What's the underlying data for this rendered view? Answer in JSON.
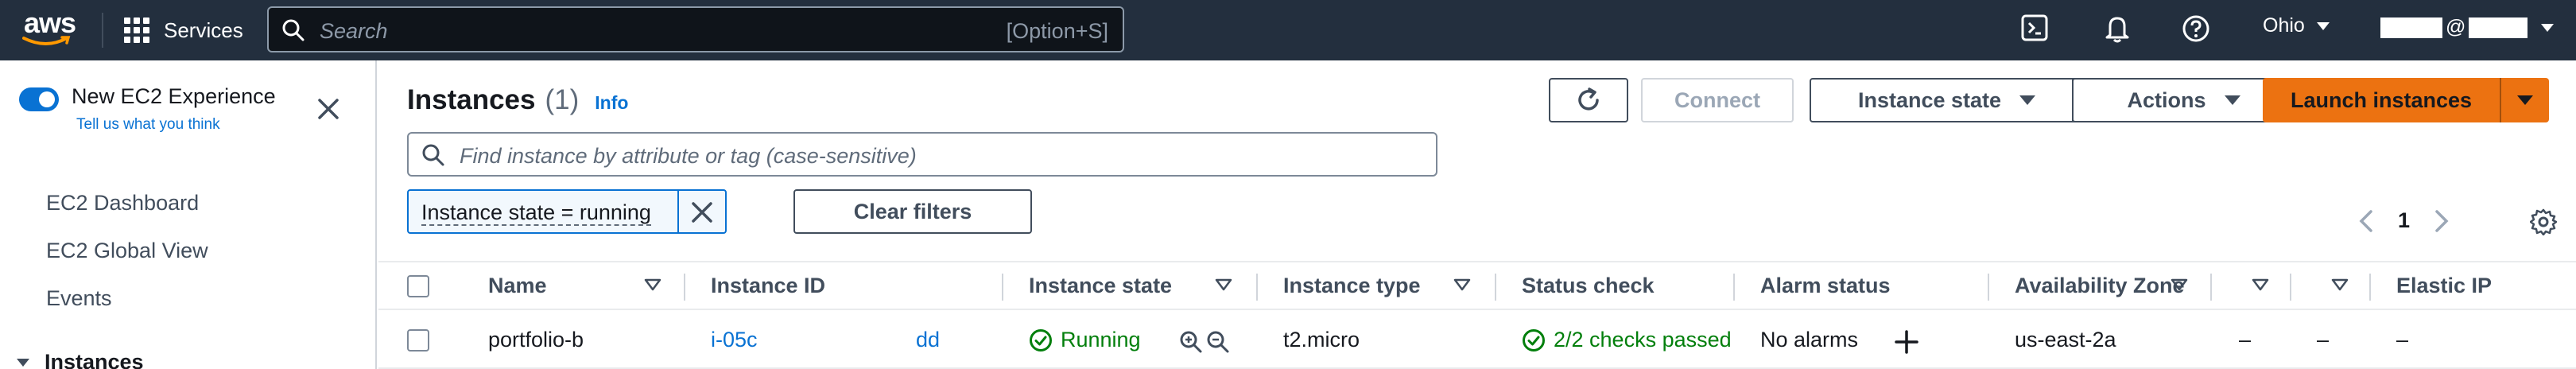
{
  "nav": {
    "logo_text": "aws",
    "services_label": "Services",
    "search_placeholder": "Search",
    "search_shortcut": "[Option+S]",
    "region": "Ohio",
    "account_at": "@"
  },
  "sidebar": {
    "experience_label": "New EC2 Experience",
    "feedback_link": "Tell us what you think",
    "items": [
      {
        "label": "EC2 Dashboard"
      },
      {
        "label": "EC2 Global View"
      },
      {
        "label": "Events"
      }
    ],
    "section_label": "Instances"
  },
  "header": {
    "title": "Instances",
    "count": "(1)",
    "info": "Info"
  },
  "toolbar": {
    "connect": "Connect",
    "instance_state": "Instance state",
    "actions": "Actions",
    "launch": "Launch instances"
  },
  "filter": {
    "placeholder": "Find instance by attribute or tag (case-sensitive)",
    "token": "Instance state = running",
    "clear": "Clear filters"
  },
  "pagination": {
    "page": "1"
  },
  "table": {
    "columns": [
      {
        "label": "Name"
      },
      {
        "label": "Instance ID"
      },
      {
        "label": "Instance state"
      },
      {
        "label": "Instance type"
      },
      {
        "label": "Status check"
      },
      {
        "label": "Alarm status"
      },
      {
        "label": "Availability Zone"
      },
      {
        "label": ""
      },
      {
        "label": ""
      },
      {
        "label": "Elastic IP"
      }
    ],
    "rows": [
      {
        "name": "portfolio-b",
        "instance_id": "i-05c",
        "instance_id_suffix": "dd",
        "state": "Running",
        "type": "t2.micro",
        "status_check": "2/2 checks passed",
        "alarm": "No alarms",
        "az": "us-east-2a",
        "extra1": "–",
        "extra2": "–",
        "elastic_ip": "–"
      }
    ]
  },
  "colors": {
    "nav_bg": "#232f3e",
    "accent": "#0972d3",
    "primary_button": "#ec7211",
    "success": "#037f0c"
  }
}
